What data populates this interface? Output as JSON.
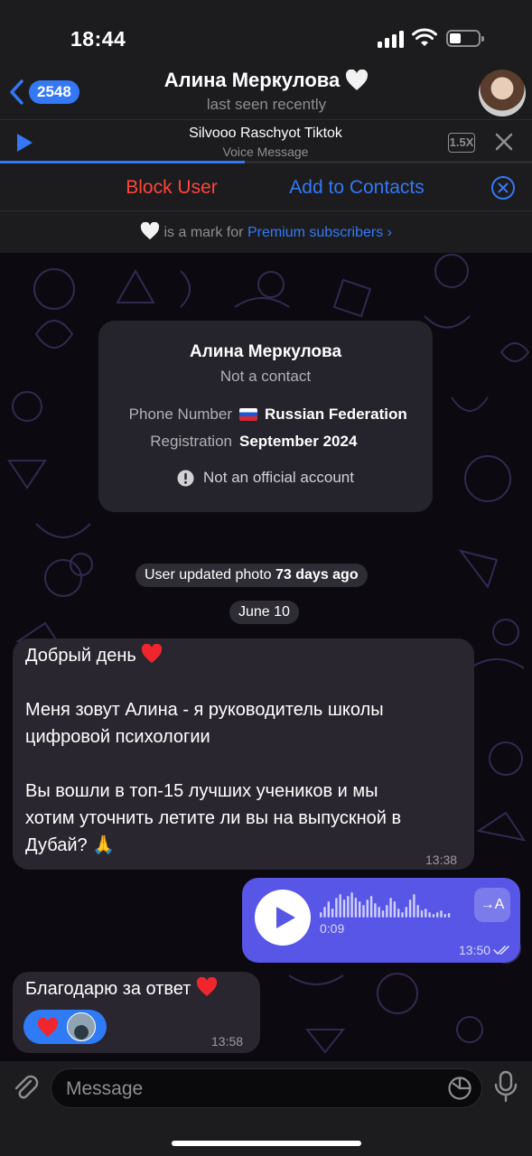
{
  "status_bar": {
    "time": "18:44"
  },
  "header": {
    "back_count": "2548",
    "title": "Алина Меркулова",
    "subtitle": "last seen recently"
  },
  "player": {
    "title": "Silvooo Raschyot Tiktok",
    "subtitle": "Voice Message",
    "speed": "1.5X",
    "progress": 0.46
  },
  "actions": {
    "block_user": "Block User",
    "add_to_contacts": "Add to Contacts"
  },
  "premium": {
    "text": "is a mark for",
    "link": "Premium subscribers",
    "chevron": "›"
  },
  "info_card": {
    "name": "Алина Меркулова",
    "status": "Not a contact",
    "phone_label": "Phone Number",
    "phone_value": "Russian Federation",
    "registration_label": "Registration",
    "registration_value": "September 2024",
    "official_note": "Not an official account"
  },
  "service": {
    "photo_prefix": "User updated photo",
    "photo_when": "73 days ago",
    "date": "June 10"
  },
  "messages": [
    {
      "direction": "in",
      "line1": "Добрый день",
      "line2": "Меня зовут Алина - я руководитель школы",
      "line3": "цифровой психологии",
      "line4": "Вы вошли в топ-15 лучших учеников и мы",
      "line5": "хотим уточнить летите ли вы на выпускной в",
      "line6": "Дубай?",
      "emoji_end": "🙏",
      "time": "13:38"
    },
    {
      "direction": "out",
      "type": "voice",
      "duration": "0:09",
      "transcribe": "→A",
      "time": "13:50"
    },
    {
      "direction": "in",
      "text": "Благодарю за ответ",
      "time": "13:58"
    }
  ],
  "input": {
    "placeholder": "Message"
  },
  "icons": {
    "back": "chevron-left-icon",
    "play": "play-icon",
    "close": "close-icon",
    "dismiss": "close-circle-icon",
    "attach": "paperclip-icon",
    "sticker": "sticker-icon",
    "mic": "microphone-icon"
  },
  "colors": {
    "accent": "#3478f6",
    "danger": "#ff453a",
    "outgoing_bubble": "#5856e6",
    "incoming_bubble": "#2a2630"
  }
}
